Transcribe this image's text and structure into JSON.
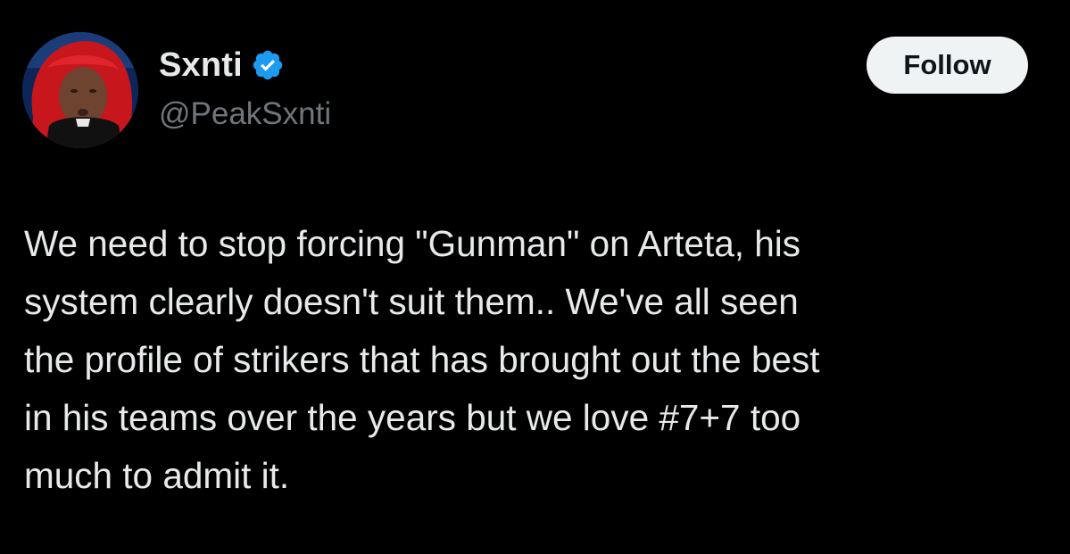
{
  "author": {
    "display_name": "Sxnti",
    "handle": "@PeakSxnti",
    "verified": true,
    "verified_icon": "verified-badge-icon"
  },
  "actions": {
    "follow_label": "Follow"
  },
  "tweet": {
    "lines": [
      "We need to stop forcing \"Gunman\" on Arteta, his",
      "system clearly doesn't suit them.. We've all seen",
      "the profile of strikers that has brought out the best",
      "in his teams over the years but we love #7+7 too",
      "much to admit it."
    ]
  },
  "colors": {
    "background": "#000000",
    "text": "#e7e9ea",
    "secondary_text": "#71767b",
    "verified_blue": "#1d9bf0",
    "button_bg": "#eff3f4",
    "button_text": "#0f1419"
  }
}
